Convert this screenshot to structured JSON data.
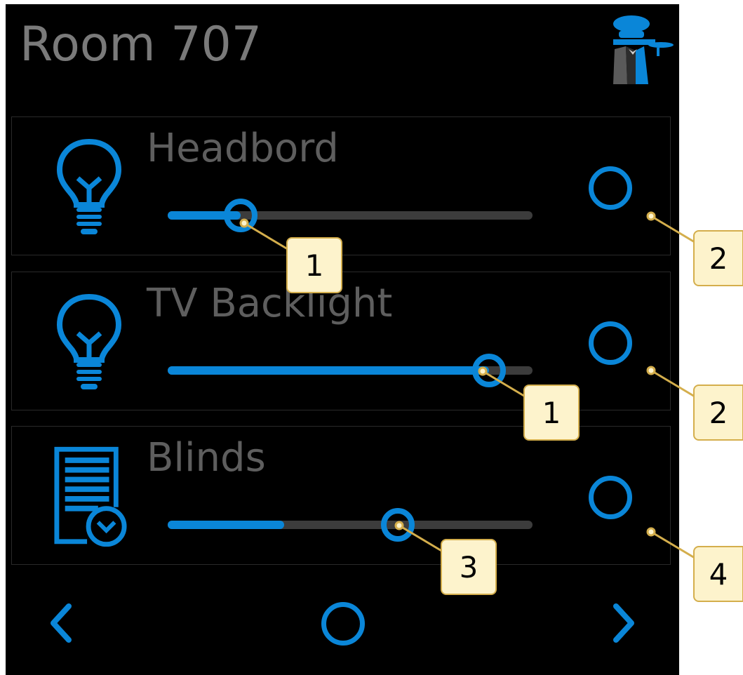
{
  "screen": {
    "title": "Room 707",
    "logo_icon": "butler-icon"
  },
  "devices": [
    {
      "label": "Headbord",
      "icon": "lightbulb-icon",
      "level_percent": 20
    },
    {
      "label": "TV Backlight",
      "icon": "lightbulb-icon",
      "level_percent": 88
    },
    {
      "label": "Blinds",
      "icon": "blinds-icon",
      "level_percent": 32,
      "thumb_percent": 63
    }
  ],
  "nav": {
    "prev_icon": "chevron-left-icon",
    "home_icon": "circle-icon",
    "next_icon": "chevron-right-icon"
  },
  "callouts": [
    "1",
    "2",
    "1",
    "2",
    "3",
    "4"
  ],
  "colors": {
    "accent": "#0a86d8",
    "background": "#000000",
    "title_text": "#7a7a7a",
    "label_text": "#5e5e5e",
    "callout_fill": "#fdf3cc",
    "callout_border": "#d4ae4c"
  }
}
